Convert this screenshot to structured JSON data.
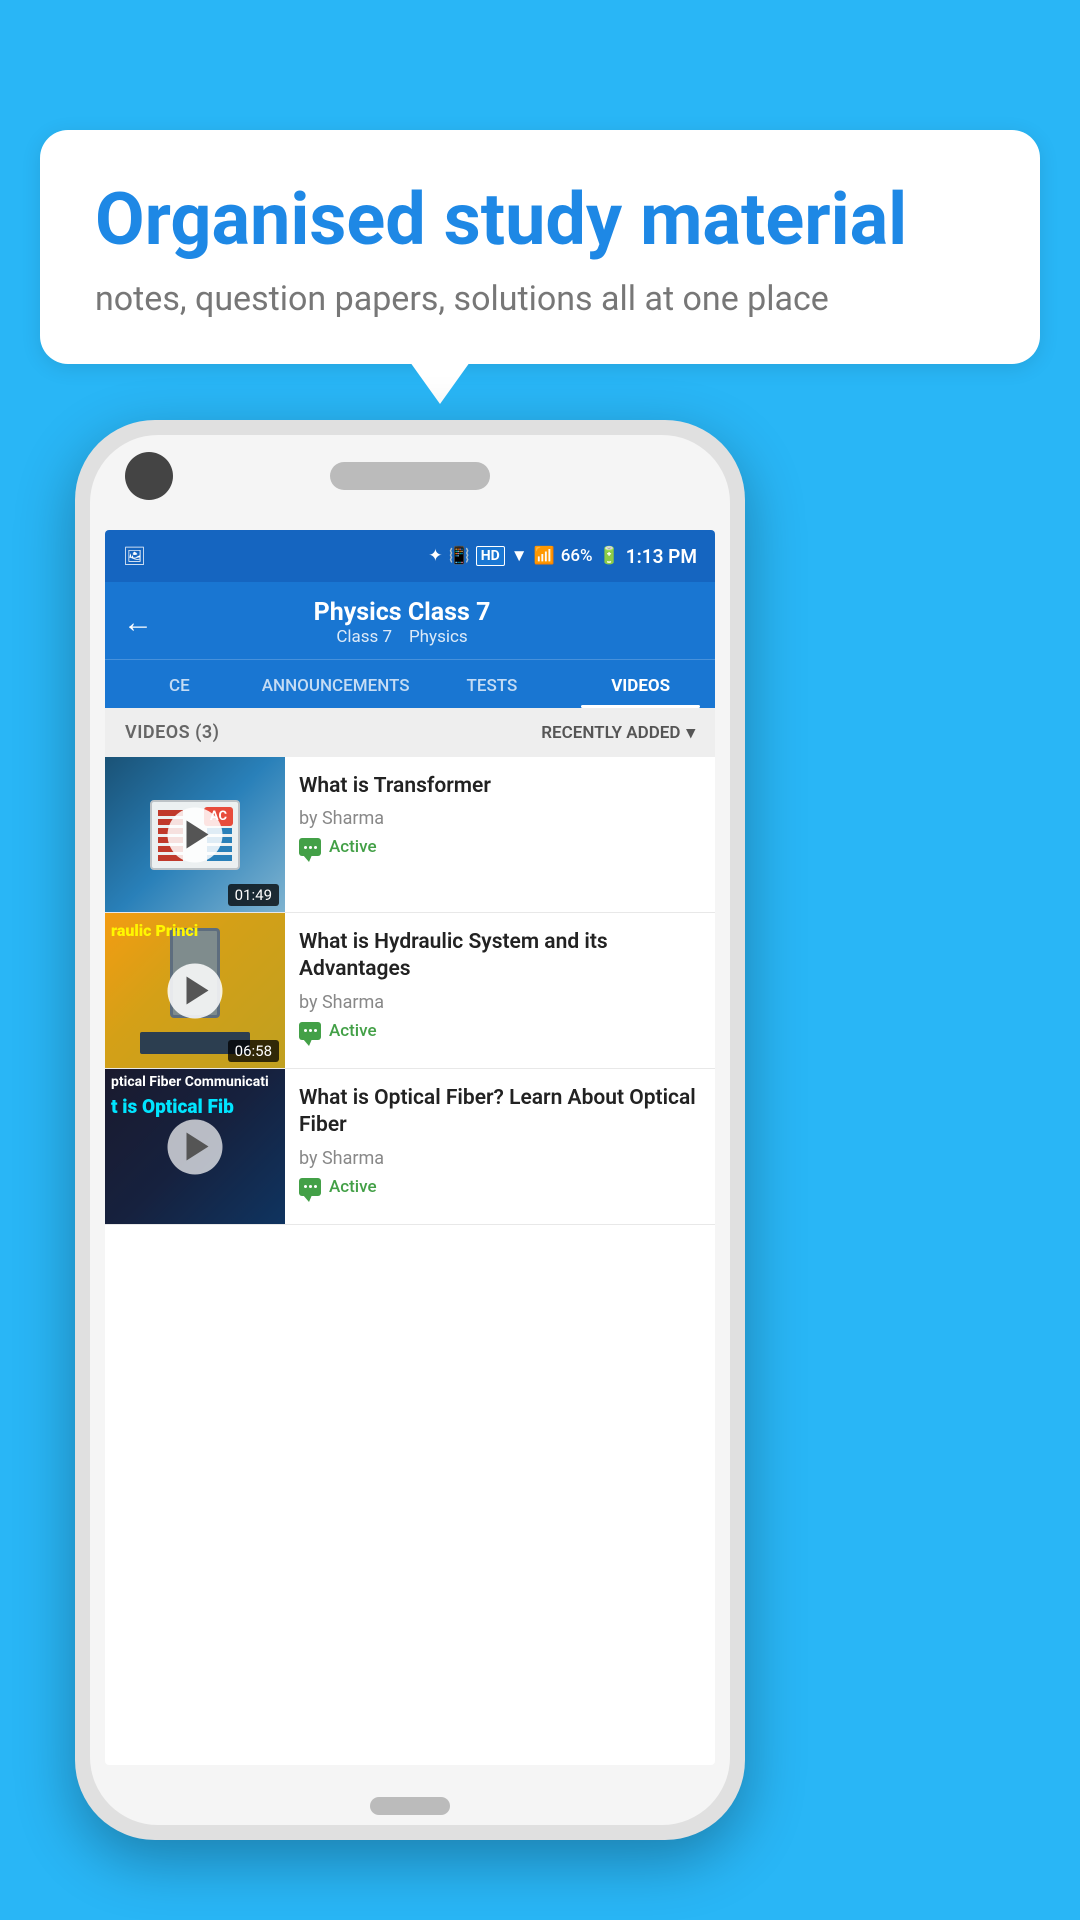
{
  "background_color": "#29b6f6",
  "speech_bubble": {
    "heading": "Organised study material",
    "subtext": "notes, question papers, solutions all at one place"
  },
  "phone": {
    "status_bar": {
      "battery": "66%",
      "time": "1:13 PM",
      "icons": [
        "bluetooth",
        "signal",
        "hd",
        "wifi",
        "cell",
        "battery"
      ]
    },
    "app_bar": {
      "title": "Physics Class 7",
      "subtitle_class": "Class 7",
      "subtitle_subject": "Physics",
      "back_label": "←"
    },
    "tabs": [
      {
        "id": "ce",
        "label": "CE",
        "active": false
      },
      {
        "id": "announcements",
        "label": "ANNOUNCEMENTS",
        "active": false
      },
      {
        "id": "tests",
        "label": "TESTS",
        "active": false
      },
      {
        "id": "videos",
        "label": "VIDEOS",
        "active": true
      }
    ],
    "videos_section": {
      "count_label": "VIDEOS (3)",
      "sort_label": "RECENTLY ADDED",
      "videos": [
        {
          "id": "v1",
          "title": "What is  Transformer",
          "author": "by Sharma",
          "status": "Active",
          "duration": "01:49",
          "thumb_type": "transformer"
        },
        {
          "id": "v2",
          "title": "What is Hydraulic System and its Advantages",
          "author": "by Sharma",
          "status": "Active",
          "duration": "06:58",
          "thumb_type": "hydraulic",
          "thumb_text": "raulic Princi"
        },
        {
          "id": "v3",
          "title": "What is Optical Fiber? Learn About Optical Fiber",
          "author": "by Sharma",
          "status": "Active",
          "duration": "",
          "thumb_type": "optical",
          "thumb_line1": "ptical Fiber Communicati",
          "thumb_line2": "t is Optical Fib"
        }
      ]
    }
  }
}
